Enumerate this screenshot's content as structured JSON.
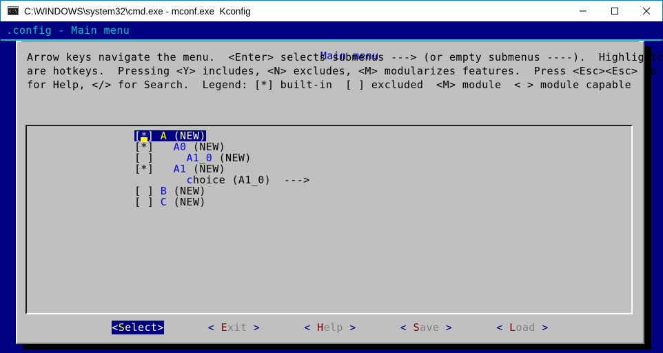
{
  "window": {
    "title": "C:\\WINDOWS\\system32\\cmd.exe - mconf.exe  Kconfig",
    "icon": "console-icon",
    "minimize_label": "minimize-icon",
    "maximize_label": "maximize-icon",
    "close_label": "close-icon"
  },
  "console": {
    "status_line": ".config - Main menu",
    "colors": {
      "background": "#000080",
      "status_text": "#00c8c8",
      "dialog_bg": "#c0c0c0",
      "highlight_bg": "#000080",
      "hotkey": "#0000ee",
      "selected_hotkey": "#ffff00",
      "button_hotkey": "#800000"
    }
  },
  "dialog": {
    "title": "Main menu",
    "help_lines": [
      "Arrow keys navigate the menu.  <Enter> selects submenus ---> (or empty submenus ----).  Highlighted letters",
      "are hotkeys.  Pressing <Y> includes, <N> excludes, <M> modularizes features.  Press <Esc><Esc> to exit, <?>",
      "for Help, </> for Search.  Legend: [*] built-in  [ ] excluded  <M> module  < > module capable"
    ]
  },
  "menu": {
    "items": [
      {
        "marker": "[*]",
        "indent": 0,
        "hotkey": "A",
        "rest": " (NEW)",
        "selected": true
      },
      {
        "marker": "[*]",
        "indent": 1,
        "hotkey": "A0",
        "rest": " (NEW)",
        "selected": false
      },
      {
        "marker": "[ ]",
        "indent": 2,
        "hotkey": "A1_0",
        "rest": " (NEW)",
        "selected": false
      },
      {
        "marker": "[*]",
        "indent": 1,
        "hotkey": "A1",
        "rest": " (NEW)",
        "selected": false
      },
      {
        "marker": "   ",
        "indent": 2,
        "hotkey": "c",
        "rest": "hoice (A1_0)  --->",
        "selected": false
      },
      {
        "marker": "[ ]",
        "indent": 0,
        "hotkey": "B",
        "rest": " (NEW)",
        "selected": false
      },
      {
        "marker": "[ ]",
        "indent": 0,
        "hotkey": "C",
        "rest": " (NEW)",
        "selected": false
      }
    ]
  },
  "buttons": [
    {
      "open": "<",
      "hotkey": "S",
      "rest": "elect",
      "close": ">",
      "active": true,
      "name": "select"
    },
    {
      "open": "< ",
      "hotkey": "E",
      "rest": "xit",
      "close": " >",
      "active": false,
      "name": "exit"
    },
    {
      "open": "< ",
      "hotkey": "H",
      "rest": "elp",
      "close": " >",
      "active": false,
      "name": "help"
    },
    {
      "open": "< ",
      "hotkey": "S",
      "rest": "ave",
      "close": " >",
      "active": false,
      "name": "save"
    },
    {
      "open": "< ",
      "hotkey": "L",
      "rest": "oad",
      "close": " >",
      "active": false,
      "name": "load"
    }
  ]
}
